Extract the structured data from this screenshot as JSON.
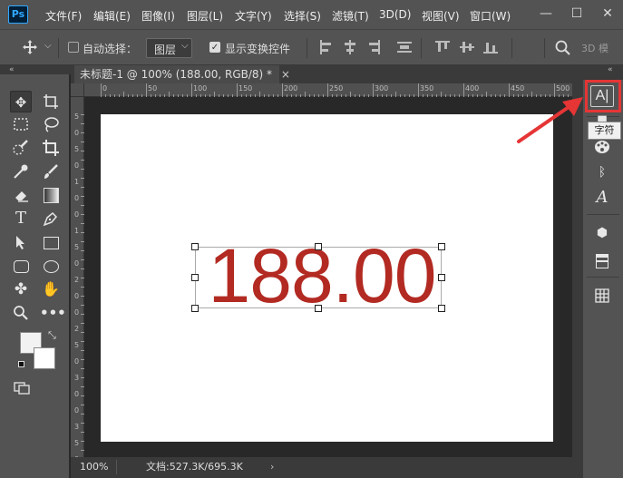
{
  "app": {
    "logo": "Ps"
  },
  "menu": [
    "文件(F)",
    "编辑(E)",
    "图像(I)",
    "图层(L)",
    "文字(Y)",
    "选择(S)",
    "滤镜(T)",
    "3D(D)",
    "视图(V)",
    "窗口(W)"
  ],
  "window_controls": {
    "minimize": "—",
    "restore": "☐",
    "close": "✕"
  },
  "options": {
    "auto_select_label": "自动选择：",
    "auto_select_checked": false,
    "target_value": "图层",
    "show_transform_label": "显示变换控件",
    "show_transform_checked": true,
    "mode_3d_label": "3D 模"
  },
  "document": {
    "tab_title": "未标题-1 @ 100% (188.00, RGB/8) *",
    "ruler_h_labels": [
      "0",
      "50",
      "100",
      "150",
      "200",
      "250",
      "300",
      "350",
      "400",
      "450",
      "500"
    ],
    "ruler_v_labels": [
      "5",
      "0",
      "5",
      "0",
      "1",
      "0",
      "0",
      "1",
      "5",
      "0",
      "2",
      "0",
      "0",
      "2",
      "5",
      "0",
      "3",
      "0",
      "0",
      "3",
      "5",
      "0"
    ],
    "text_layer": "188.00",
    "text_color": "#b22a22"
  },
  "status": {
    "zoom": "100%",
    "doc_info": "文档:527.3K/695.3K"
  },
  "right_panel": {
    "tooltip": "字符"
  },
  "icons": {
    "toolbar": [
      "move-icon",
      "artboard-icon",
      "marquee-icon",
      "lasso-icon",
      "quick-select-icon",
      "crop-icon",
      "eyedropper-icon",
      "brush-icon",
      "eraser-icon",
      "gradient-icon",
      "type-icon",
      "pen-icon",
      "path-select-icon",
      "rectangle-icon",
      "rounded-rect-icon",
      "ellipse-icon",
      "custom-shape-icon",
      "hand-icon",
      "zoom-icon",
      "more-tools-icon"
    ],
    "right": [
      "character-panel-icon",
      "paragraph-icon",
      "color-palette-icon",
      "libraries-icon",
      "glyphs-icon",
      "3d-icon",
      "properties-icon",
      "grid-icon"
    ]
  }
}
